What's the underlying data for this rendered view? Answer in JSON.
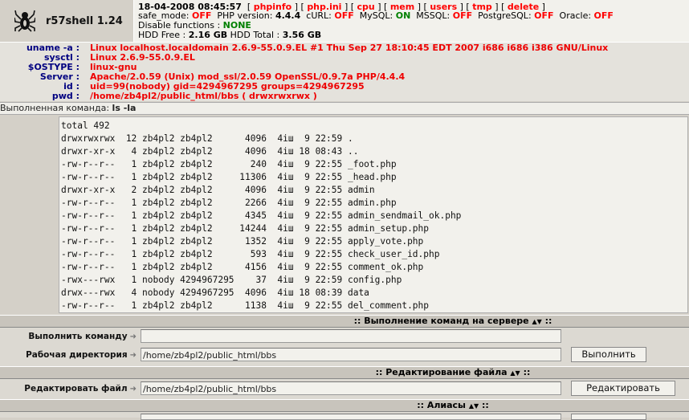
{
  "header": {
    "title": "r57shell 1.24",
    "datetime": "18-04-2008 08:45:57",
    "links": [
      "phpinfo",
      "php.ini",
      "cpu",
      "mem",
      "users",
      "tmp",
      "delete"
    ],
    "safe_mode_label": "safe_mode:",
    "safe_mode_value": "OFF",
    "php_version_label": "PHP version:",
    "php_version_value": "4.4.4",
    "curl_label": "cURL:",
    "curl_value": "OFF",
    "mysql_label": "MySQL:",
    "mysql_value": "ON",
    "mssql_label": "MSSQL:",
    "mssql_value": "OFF",
    "postgresql_label": "PostgreSQL:",
    "postgresql_value": "OFF",
    "oracle_label": "Oracle:",
    "oracle_value": "OFF",
    "disable_functions_label": "Disable functions :",
    "disable_functions_value": "NONE",
    "hdd_free_label": "HDD Free :",
    "hdd_free_value": "2.16 GB",
    "hdd_total_label": "HDD Total :",
    "hdd_total_value": "3.56 GB"
  },
  "sysinfo": {
    "uname_label": "uname -a :",
    "uname_value": "Linux localhost.localdomain 2.6.9-55.0.9.EL #1 Thu Sep 27 18:10:45 EDT 2007 i686 i686 i386 GNU/Linux",
    "sysctl_label": "sysctl :",
    "sysctl_value": "Linux 2.6.9-55.0.9.EL",
    "ostype_label": "$OSTYPE :",
    "ostype_value": "linux-gnu",
    "server_label": "Server :",
    "server_value": "Apache/2.0.59 (Unix) mod_ssl/2.0.59 OpenSSL/0.9.7a PHP/4.4.4",
    "id_label": "id :",
    "id_value": "uid=99(nobody) gid=4294967295 groups=4294967295",
    "pwd_label": "pwd :",
    "pwd_value": "/home/zb4pl2/public_html/bbs   ( drwxrwxrwx )"
  },
  "command_bar": {
    "label": "Выполненная команда:",
    "command": "ls -la"
  },
  "output": {
    "lines": [
      "total 492",
      "drwxrwxrwx  12 zb4pl2 zb4pl2      4096  4іш  9 22:59 .",
      "drwxr-xr-x   4 zb4pl2 zb4pl2      4096  4іш 18 08:43 ..",
      "-rw-r--r--   1 zb4pl2 zb4pl2       240  4іш  9 22:55 _foot.php",
      "-rw-r--r--   1 zb4pl2 zb4pl2     11306  4іш  9 22:55 _head.php",
      "drwxr-xr-x   2 zb4pl2 zb4pl2      4096  4іш  9 22:55 admin",
      "-rw-r--r--   1 zb4pl2 zb4pl2      2266  4іш  9 22:55 admin.php",
      "-rw-r--r--   1 zb4pl2 zb4pl2      4345  4іш  9 22:55 admin_sendmail_ok.php",
      "-rw-r--r--   1 zb4pl2 zb4pl2     14244  4іш  9 22:55 admin_setup.php",
      "-rw-r--r--   1 zb4pl2 zb4pl2      1352  4іш  9 22:55 apply_vote.php",
      "-rw-r--r--   1 zb4pl2 zb4pl2       593  4іш  9 22:55 check_user_id.php",
      "-rw-r--r--   1 zb4pl2 zb4pl2      4156  4іш  9 22:55 comment_ok.php",
      "-rwx---rwx   1 nobody 4294967295    37  4іш  9 22:59 config.php",
      "drwx---rwx   4 nobody 4294967295  4096  4іш 18 08:39 data",
      "-rw-r--r--   1 zb4pl2 zb4pl2      1138  4іш  9 22:55 del_comment.php"
    ]
  },
  "exec_section": {
    "title": ":: Выполнение команд на сервере",
    "title_end": "::",
    "command_label": "Выполнить команду",
    "command_value": "",
    "workdir_label": "Рабочая директория",
    "workdir_value": "/home/zb4pl2/public_html/bbs",
    "run_button": "Выполнить"
  },
  "edit_section": {
    "title": ":: Редактирование файла",
    "title_end": "::",
    "file_label": "Редактировать файл",
    "file_value": "/home/zb4pl2/public_html/bbs",
    "edit_button": "Редактировать"
  },
  "alias_section": {
    "title": ":: Алиасы",
    "title_end": "::"
  }
}
